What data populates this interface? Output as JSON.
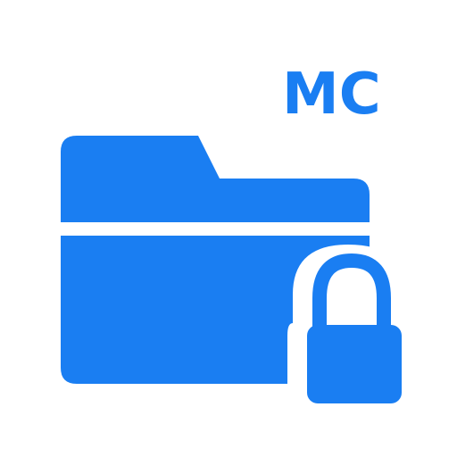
{
  "app": {
    "icon_name": "locked-folder-icon",
    "badge_text": "MC",
    "lock_icon": "padlock-icon"
  },
  "colors": {
    "primary": "#1a7ef2",
    "background": "#ffffff"
  }
}
